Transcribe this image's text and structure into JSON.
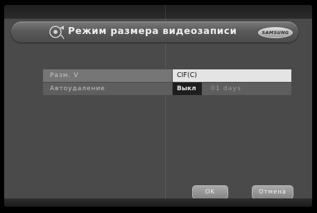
{
  "title": "Режим размера видеозаписи",
  "brand_logo": "SAMSUNG",
  "title_icon": "record-settings-icon",
  "settings": [
    {
      "label": "Разм. V",
      "value": "CIF(C)"
    },
    {
      "label": "Автоудаление",
      "value": "Выкл",
      "extra": "01  days"
    }
  ],
  "buttons": {
    "ok": "OK",
    "cancel": "Отмена"
  },
  "colors": {
    "panel": "#4a4a4a",
    "selected_row": "#e4e4e4",
    "button": "#999999"
  }
}
